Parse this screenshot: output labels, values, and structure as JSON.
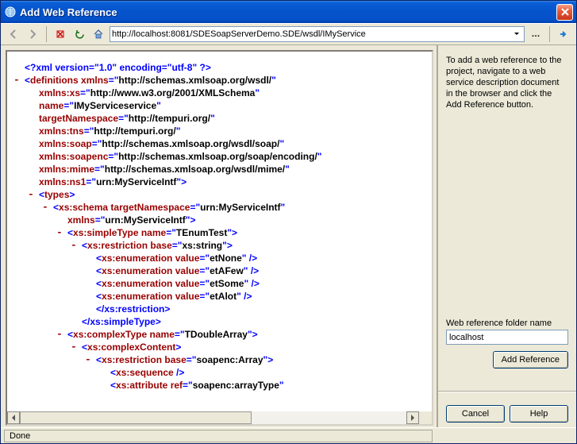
{
  "title": "Add Web Reference",
  "url": "http://localhost:8081/SDESoapServerDemo.SDE/wsdl/IMyService",
  "instructions": "To add a web reference to the project, navigate to a web service description document in the browser and click the Add Reference button.",
  "folder_label": "Web reference folder name",
  "folder_value": "localhost",
  "buttons": {
    "add_reference": "Add Reference",
    "cancel": "Cancel",
    "help": "Help"
  },
  "status": "Done",
  "xml": {
    "decl": "<?xml version=\"1.0\" encoding=\"utf-8\" ?>",
    "root": "definitions",
    "root_ns_value": "http://schemas.xmlsoap.org/wsdl/",
    "attrs": [
      {
        "name": "xmlns:xs",
        "value": "http://www.w3.org/2001/XMLSchema"
      },
      {
        "name": "name",
        "bold": "IMyServiceservice"
      },
      {
        "name": "targetNamespace",
        "bold": "http://tempuri.org/"
      },
      {
        "name": "xmlns:tns",
        "value": "http://tempuri.org/"
      },
      {
        "name": "xmlns:soap",
        "value": "http://schemas.xmlsoap.org/wsdl/soap/"
      },
      {
        "name": "xmlns:soapenc",
        "value": "http://schemas.xmlsoap.org/soap/encoding/"
      },
      {
        "name": "xmlns:mime",
        "value": "http://schemas.xmlsoap.org/wsdl/mime/"
      },
      {
        "name": "xmlns:ns1",
        "value": "urn:MyServiceIntf"
      }
    ],
    "types_tag": "types",
    "schema_tag": "xs:schema",
    "schema_tn": "urn:MyServiceIntf",
    "schema_xmlns": "urn:MyServiceIntf",
    "simpleType_tag": "xs:simpleType",
    "simpleType_name": "TEnumTest",
    "restriction_tag": "xs:restriction",
    "restriction_base1": "xs:string",
    "enumeration_tag": "xs:enumeration",
    "enum_values": [
      "etNone",
      "etAFew",
      "etSome",
      "etAlot"
    ],
    "close_restriction": "</xs:restriction>",
    "close_simpleType": "</xs:simpleType>",
    "complexType_tag": "xs:complexType",
    "complexType_name": "TDoubleArray",
    "complexContent_tag": "xs:complexContent",
    "restriction_base2": "soapenc:Array",
    "sequence_tag": "xs:sequence",
    "attribute_tag": "xs:attribute",
    "attribute_ref": "soapenc:arrayType"
  }
}
